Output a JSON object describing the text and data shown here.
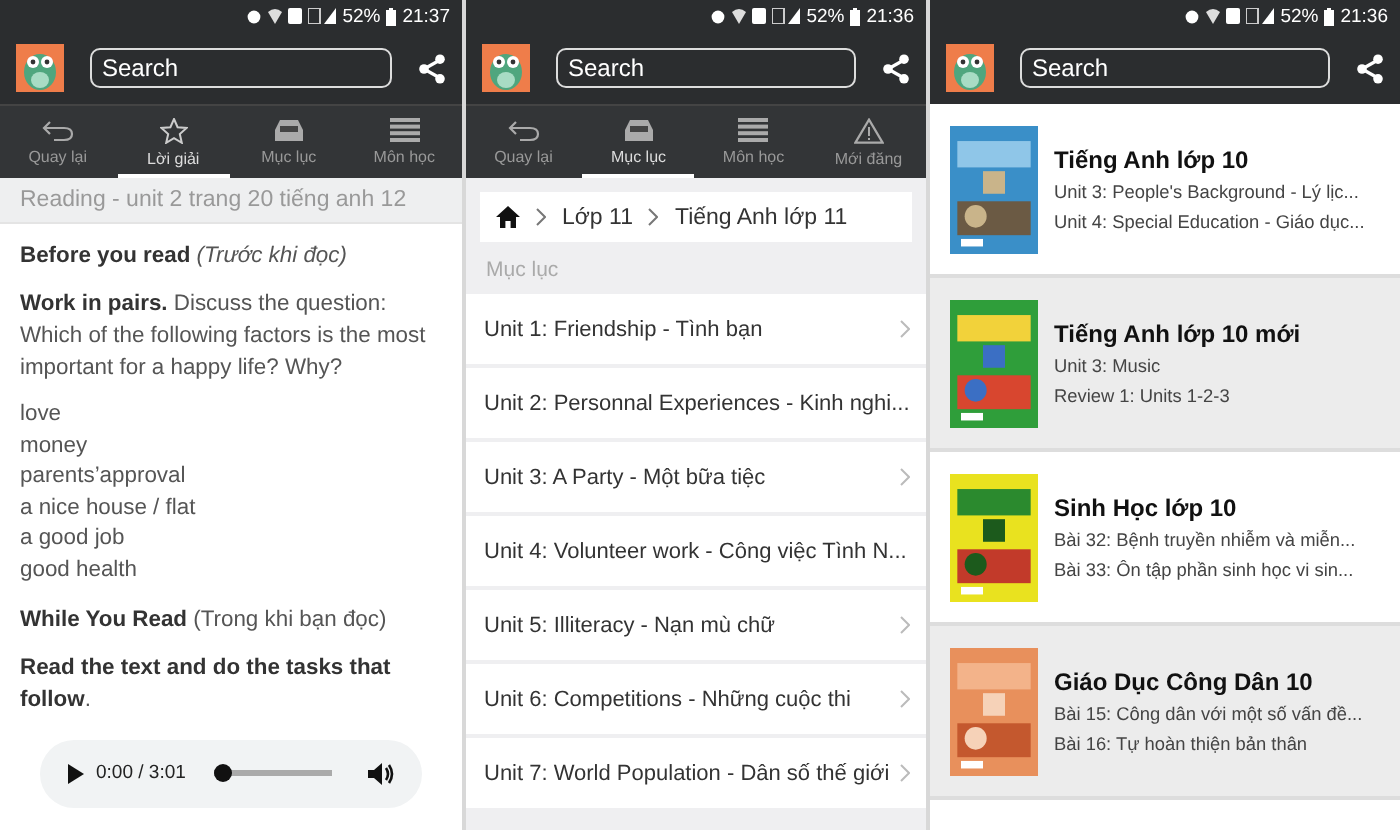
{
  "screens": [
    {
      "kind": "lesson",
      "status_bar": {
        "battery": "52%",
        "time": "21:37"
      },
      "search": {
        "placeholder": "Search"
      },
      "tabs": [
        {
          "kind": "back",
          "label": "Quay lại",
          "selected": false
        },
        {
          "kind": "star",
          "label": "Lời giải",
          "selected": true
        },
        {
          "kind": "tray",
          "label": "Mục lục",
          "selected": false
        },
        {
          "kind": "list",
          "label": "Môn học",
          "selected": false
        }
      ],
      "title": "Reading - unit 2 trang 20 tiếng anh 12",
      "blocks": [
        {
          "kind": "paragraph",
          "text": "**Before you read** *(Trước khi đọc)*"
        },
        {
          "kind": "paragraph",
          "text": "**Work in pairs.** Discuss the question: Which of the following factors is the most important for a happy life? Why?"
        },
        {
          "kind": "lines",
          "lines": [
            "love",
            "money",
            "parents’approval",
            "a nice house / flat",
            "a good job",
            "good health"
          ]
        },
        {
          "kind": "paragraph",
          "text": "**While You Read** (Trong khi bạn đọc)"
        },
        {
          "kind": "paragraph",
          "text": "**Read the text and do the tasks that follow**."
        },
        {
          "kind": "audio",
          "time": "0:00 / 3:01",
          "level": 0
        }
      ]
    },
    {
      "kind": "toc",
      "status_bar": {
        "battery": "52%",
        "time": "21:36"
      },
      "search": {
        "placeholder": "Search"
      },
      "tabs": [
        {
          "kind": "back",
          "label": "Quay lại",
          "selected": false
        },
        {
          "kind": "tray",
          "label": "Mục lục",
          "selected": true
        },
        {
          "kind": "list",
          "label": "Môn học",
          "selected": false
        },
        {
          "kind": "warning",
          "label": "Mới đăng",
          "selected": false
        }
      ],
      "breadcrumb": [
        "Lớp 11",
        "Tiếng Anh lớp 11"
      ],
      "section": "Mục lục",
      "items": [
        "Unit 1: Friendship - Tình bạn",
        "Unit 2: Personnal Experiences - Kinh nghi...",
        "Unit 3: A Party - Một bữa tiệc",
        "Unit 4: Volunteer work - Công việc Tình N...",
        "Unit 5: Illiteracy - Nạn mù chữ",
        "Unit 6: Competitions - Những cuộc thi",
        "Unit 7: World Population - Dân số thế giới"
      ]
    },
    {
      "kind": "books",
      "status_bar": {
        "battery": "52%",
        "time": "21:36"
      },
      "search": {
        "placeholder": "Search"
      },
      "books": [
        {
          "title": "Tiếng Anh lớp 10",
          "lines": [
            "Unit 3: People's Background - Lý lịc...",
            "Unit 4: Special Education - Giáo dục..."
          ]
        },
        {
          "title": "Tiếng Anh lớp 10 mới",
          "lines": [
            "Unit 3: Music",
            "Review 1: Units 1-2-3"
          ]
        },
        {
          "title": "Sinh Học lớp 10",
          "lines": [
            "Bài 32: Bệnh truyền nhiễm và miễn...",
            "Bài 33: Ôn tập phần sinh học vi sin..."
          ]
        },
        {
          "title": "Giáo Dục Công Dân 10",
          "lines": [
            "Bài 15: Công dân với một số vấn đề...",
            "Bài 16: Tự hoàn thiện bản thân"
          ]
        }
      ]
    }
  ]
}
